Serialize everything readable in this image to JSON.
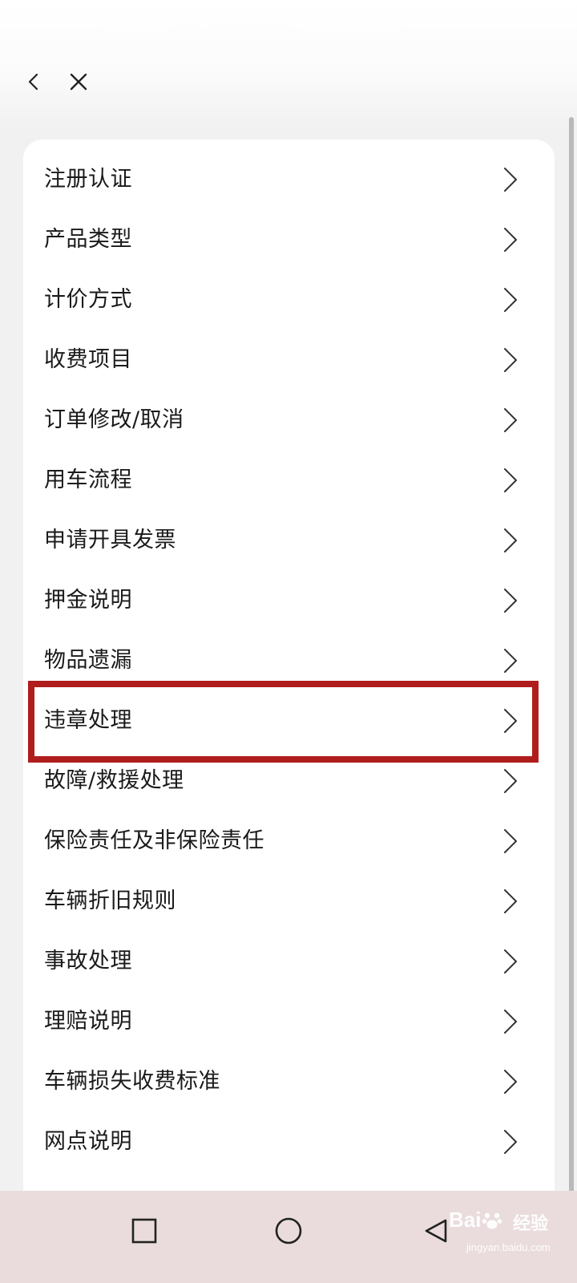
{
  "header": {
    "back_icon": "chevron-left-icon",
    "close_icon": "close-icon"
  },
  "menu": {
    "items": [
      {
        "label": "注册认证"
      },
      {
        "label": "产品类型"
      },
      {
        "label": "计价方式"
      },
      {
        "label": "收费项目"
      },
      {
        "label": "订单修改/取消"
      },
      {
        "label": "用车流程"
      },
      {
        "label": "申请开具发票"
      },
      {
        "label": "押金说明"
      },
      {
        "label": "物品遗漏"
      },
      {
        "label": "违章处理",
        "highlighted": true
      },
      {
        "label": "故障/救援处理"
      },
      {
        "label": "保险责任及非保险责任"
      },
      {
        "label": "车辆折旧规则"
      },
      {
        "label": "事故处理"
      },
      {
        "label": "理赔说明"
      },
      {
        "label": "车辆损失收费标准"
      },
      {
        "label": "网点说明"
      }
    ],
    "item_icon": "chevron-right-icon",
    "highlight_color": "#b01d1d"
  },
  "system_nav": {
    "recent_icon": "square-icon",
    "home_icon": "circle-icon",
    "back_icon": "triangle-back-icon"
  },
  "watermark": {
    "logo_left": "Bai",
    "logo_right": "经验",
    "url": "jingyan.baidu.com"
  }
}
